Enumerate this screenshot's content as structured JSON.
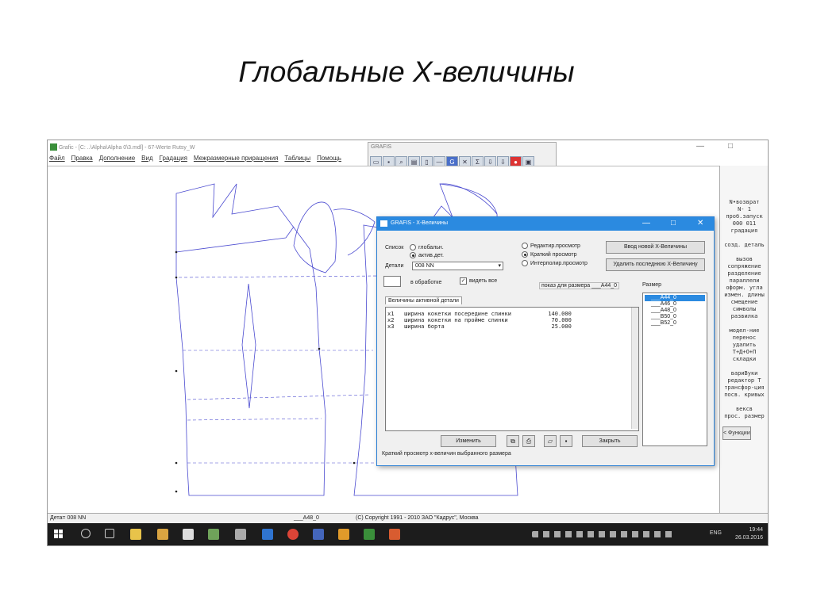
{
  "slide": {
    "title": "Глобальные X-величины"
  },
  "app": {
    "title": "Grafic - [C: ..\\Alpha\\Alpha 0\\3.mdl] - 67-Werte Rutsy_W",
    "menu": [
      "Файл",
      "Правка",
      "Дополнение",
      "Вид",
      "Градация",
      "Межразмерные приращения",
      "Таблицы",
      "Помощь"
    ],
    "window_controls": [
      "—",
      "□"
    ]
  },
  "grafis_toolbar": {
    "caption": "GRAFIS",
    "icons": [
      "open-icon",
      "save-icon",
      "zoom-icon",
      "print-icon",
      "page-icon",
      "line-icon",
      "grafis-logo-icon",
      "cross-icon",
      "sigma-icon",
      "download-icon",
      "download2-icon",
      "stop-icon",
      "image-icon"
    ]
  },
  "right_panel": {
    "lines": [
      "N•возврат",
      "N-  1",
      "проб.запуск",
      "000 011",
      "градация",
      "",
      "созд. деталь",
      "",
      "вызов",
      "сопряжение",
      "разделение",
      "параллели",
      "оформ. угла",
      "измен. длины",
      "смещение",
      "символы",
      "развилка",
      "",
      "модел-ние",
      "перенос",
      "удалить",
      "T+Д+O+П",
      "складки",
      "",
      "вариВуки",
      "редактор Т",
      "трансфор-ция",
      "посв. кривых",
      "",
      "вексв",
      "прос. размер"
    ],
    "button": "< Функции"
  },
  "status_bar": {
    "detail": "Дета= 008  NN",
    "size": "___A48_0",
    "copyright": "(C) Copyright 1991 - 2010 ЗАО \"Кадрус\", Москва"
  },
  "taskbar": {
    "lang": "ENG",
    "time": "19:44",
    "date": "26.03.2016"
  },
  "dialog": {
    "title": "GRAFIS - X-Величины",
    "title_controls": [
      "—",
      "□",
      "✕"
    ],
    "list_label": "Список",
    "radio_global": "глобальн.",
    "radio_active": "актив.дет.",
    "detail_label": "Детали",
    "detail_value": "008  NN",
    "mode_edit": "Редактир.просмотр",
    "mode_short": "Краткий просмотр",
    "mode_interp": "Интерполир.просмотр",
    "btn_new": "Ввод новой X-Величины",
    "btn_delete": "Удалить последнюю X-Величину",
    "in_processing": "в обработке",
    "show_all": "видеть все",
    "show_for_size": "показ для размера ___A44_0",
    "size_label": "Размер",
    "tab_active": "Величины активной детали",
    "rows": [
      {
        "id": "x1",
        "name": "ширина кокетки посередине спинки",
        "value": "140.000"
      },
      {
        "id": "x2",
        "name": "ширина кокетки на пройме спинки",
        "value": "70.000"
      },
      {
        "id": "x3",
        "name": "ширина борта",
        "value": "25.000"
      }
    ],
    "sizes": [
      "___A44_0",
      "___A46_0",
      "___A48_0",
      "___B50_0",
      "___B52_0"
    ],
    "btn_change": "Изменить",
    "btn_close": "Закрыть",
    "status": "Краткий просмотр x-величин выбранного размера"
  }
}
